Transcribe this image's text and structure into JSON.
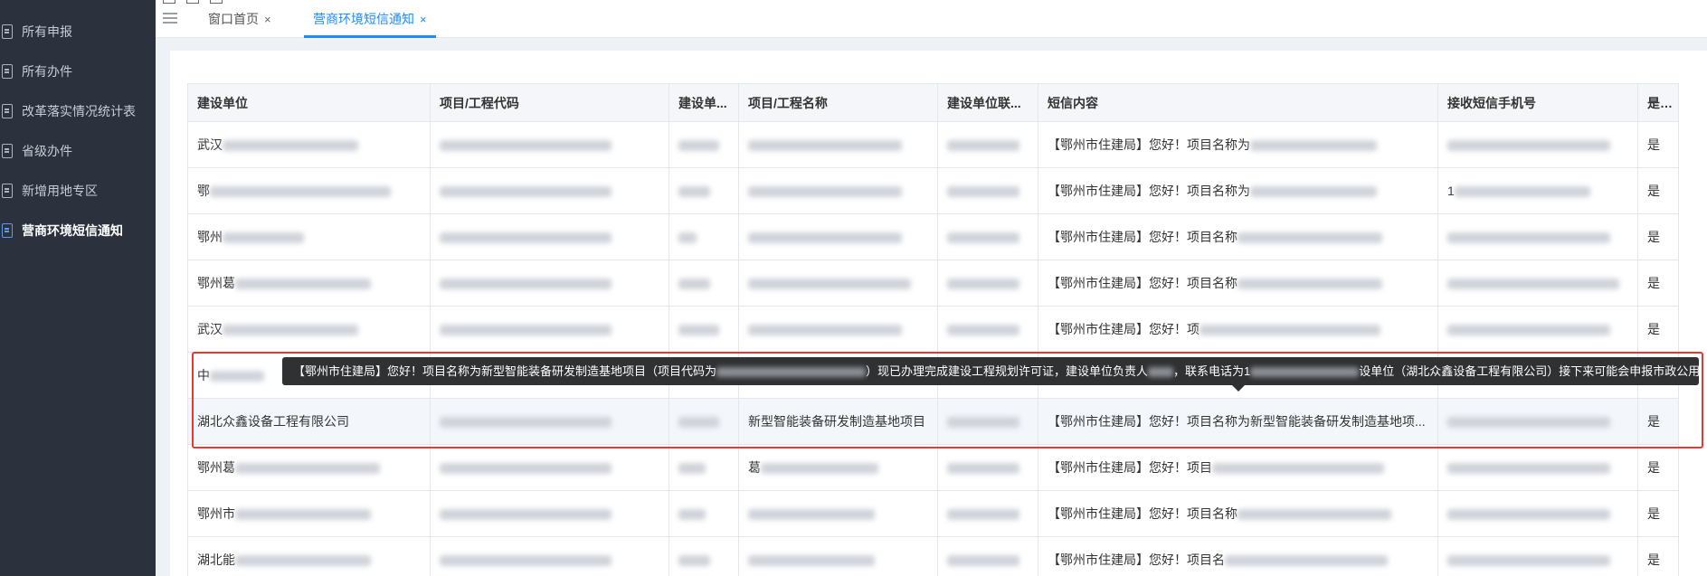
{
  "sidebar": {
    "items": [
      {
        "label": "所有申报",
        "active": false
      },
      {
        "label": "所有办件",
        "active": false
      },
      {
        "label": "改革落实情况统计表",
        "active": false
      },
      {
        "label": "省级办件",
        "active": false
      },
      {
        "label": "新增用地专区",
        "active": false
      },
      {
        "label": "营商环境短信通知",
        "active": true
      }
    ]
  },
  "tabs": [
    {
      "label": "窗口首页",
      "close": "×",
      "active": false
    },
    {
      "label": "营商环境短信通知",
      "close": "×",
      "active": true
    }
  ],
  "table": {
    "headers": [
      "建设单位",
      "项目/工程代码",
      "建设单...",
      "项目/工程名称",
      "建设单位联...",
      "短信内容",
      "接收短信手机号",
      "是..."
    ],
    "rows": [
      {
        "unit": "武汉",
        "sms": "【鄂州市住建局】您好！项目名称为",
        "flag": "是"
      },
      {
        "unit": "鄂",
        "sms": "【鄂州市住建局】您好！项目名称为",
        "phone": "1",
        "flag": "是"
      },
      {
        "unit": "鄂州",
        "sms": "【鄂州市住建局】您好！项目名称",
        "flag": "是"
      },
      {
        "unit": "鄂州葛",
        "sms": "【鄂州市住建局】您好！项目名称",
        "flag": "是"
      },
      {
        "unit": "武汉",
        "sms": "【鄂州市住建局】您好！项",
        "flag": "是"
      },
      {
        "unit": "中",
        "sms": "",
        "flag": ""
      },
      {
        "unit": "湖北众鑫设备工程有限公司",
        "name": "新型智能装备研发制造基地项目",
        "sms": "【鄂州市住建局】您好！项目名称为新型智能装备研发制造基地项...",
        "flag": "是"
      },
      {
        "unit": "鄂州葛",
        "name": "葛",
        "sms": "【鄂州市住建局】您好！项目",
        "flag": "是"
      },
      {
        "unit": "鄂州市",
        "sms": "【鄂州市住建局】您好！项目名称",
        "flag": "是"
      },
      {
        "unit": "湖北能",
        "sms": "【鄂州市住建局】您好！项目名",
        "flag": "是"
      }
    ]
  },
  "tooltip": {
    "part1": "【鄂州市住建局】您好！项目名称为新型智能装备研发制造基地项目（项目代码为",
    "part2": "）现已办理完成建设工程规划许可证，建设单位负责人",
    "part3": "，联系电话为1",
    "part4": "设单位（湖北众鑫设备工程有限公司）接下来可能会申报市政公用服务事项，请知悉!"
  },
  "colors": {
    "accent": "#1a8cff",
    "sidebar_bg": "#2b313d",
    "highlight_border": "#e53935",
    "tooltip_bg": "#303133"
  }
}
